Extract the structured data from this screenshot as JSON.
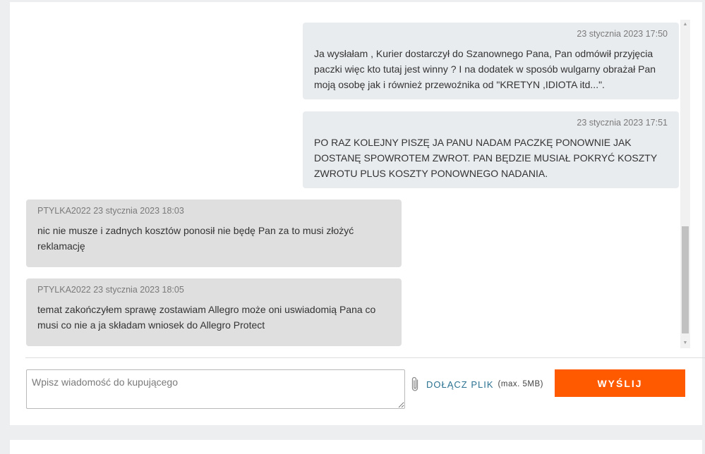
{
  "messages": [
    {
      "side": "mine",
      "author": "",
      "timestamp": "23 stycznia 2023 17:50",
      "text": "Ja wysłałam , Kurier dostarczył do Szanownego Pana, Pan odmówił przyjęcia paczki więc kto tutaj jest winny ? I na dodatek w sposób wulgarny obrażał Pan moją osobę jak i również przewoźnika od \"KRETYN ,IDIOTA itd...\"."
    },
    {
      "side": "mine",
      "author": "",
      "timestamp": "23 stycznia 2023 17:51",
      "text": "PO RAZ KOLEJNY PISZĘ JA PANU NADAM PACZKĘ PONOWNIE JAK DOSTANĘ SPOWROTEM ZWROT.  PAN BĘDZIE MUSIAŁ POKRYĆ KOSZTY ZWROTU PLUS KOSZTY PONOWNEGO NADANIA."
    },
    {
      "side": "theirs",
      "author": "PTYLKA2022",
      "timestamp": "23 stycznia 2023 18:03",
      "text": "nic nie musze i zadnych kosztów ponosił nie będę Pan za to musi złożyć reklamację"
    },
    {
      "side": "theirs",
      "author": "PTYLKA2022",
      "timestamp": "23 stycznia 2023 18:05",
      "text": "temat zakończyłem sprawę zostawiam Allegro może oni uswiadomią Pana co musi co nie a ja składam wniosek do Allegro Protect"
    }
  ],
  "composer": {
    "placeholder": "Wpisz wiadomość do kupującego",
    "value": "",
    "attach_label": "DOŁĄCZ PLIK",
    "attach_hint": "(max. 5MB)",
    "send_label": "WYŚLIJ"
  },
  "icons": {
    "attach": "paperclip-icon",
    "scroll_up": "scroll-up-arrow-icon",
    "scroll_down": "scroll-down-arrow-icon"
  },
  "colors": {
    "send_button": "#ff5a00",
    "attach_link": "#2a7291",
    "own_message_bg": "#e9ecef",
    "their_message_bg": "#dfdfdf"
  }
}
